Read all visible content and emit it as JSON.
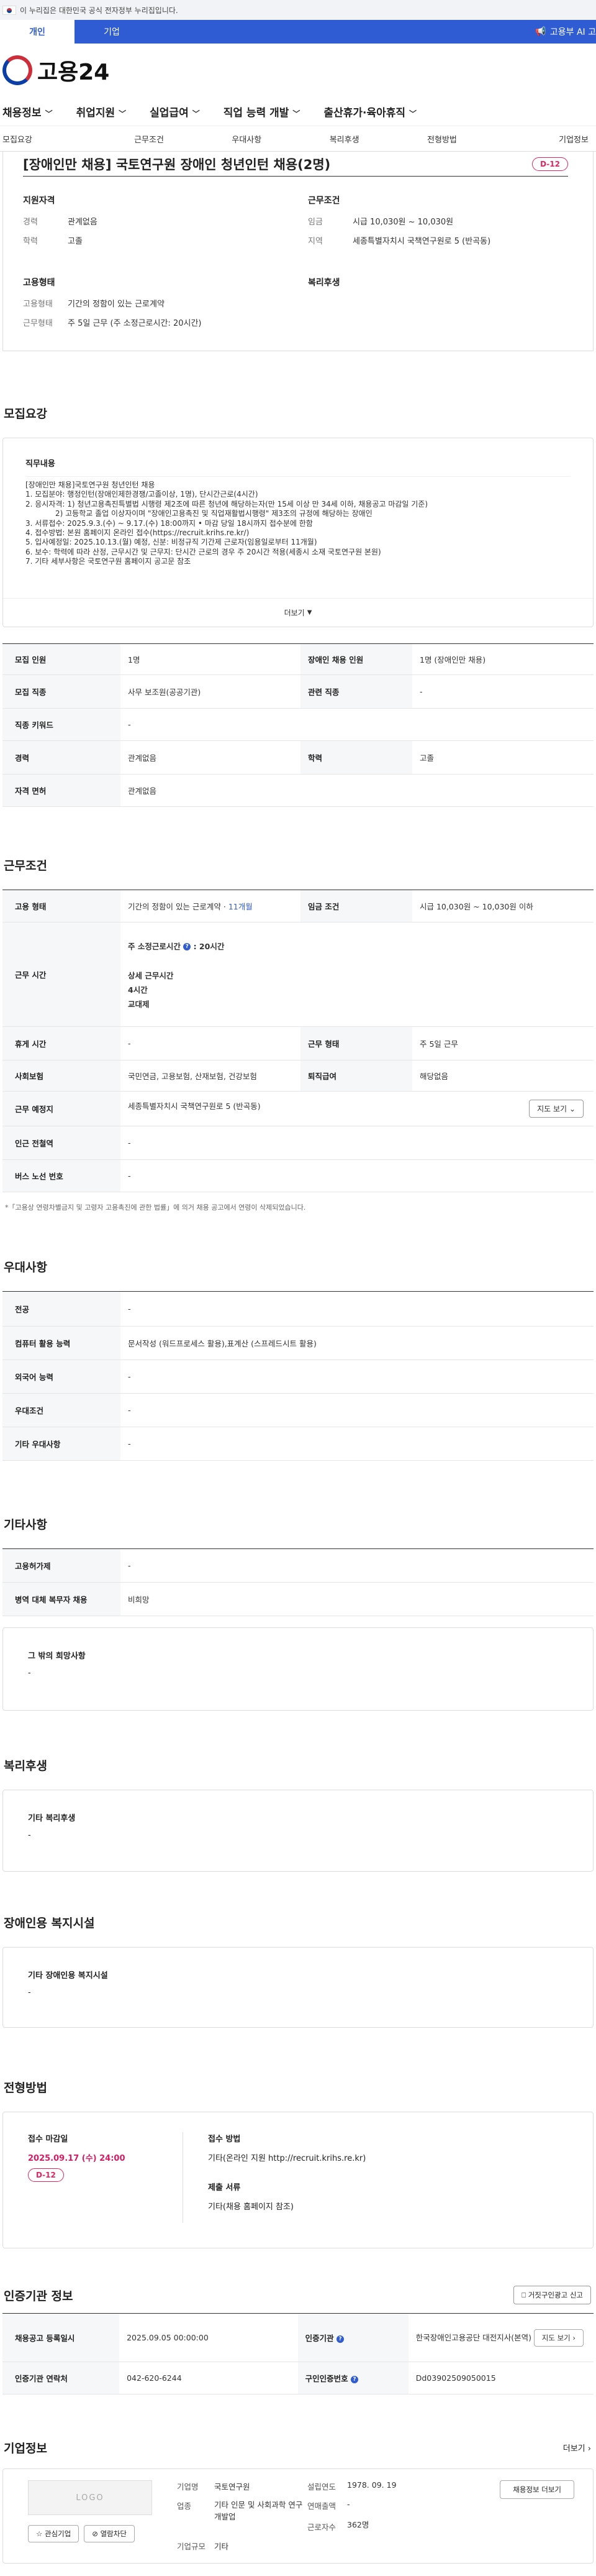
{
  "gov_banner": {
    "text": "이 누리집은 대한민국 공식 전자정부 누리집입니다."
  },
  "user_tabs": {
    "personal": "개인",
    "company": "기업",
    "ministry": "고용부 AI 고"
  },
  "logo": {
    "text": "고용24"
  },
  "main_nav": [
    {
      "label": "채용정보"
    },
    {
      "label": "취업지원"
    },
    {
      "label": "실업급여"
    },
    {
      "label": "직업 능력 개발"
    },
    {
      "label": "출산휴가·육아휴직"
    }
  ],
  "anchor_tabs": [
    "모집요강",
    "근무조건",
    "우대사항",
    "복리후생",
    "전형방법",
    "기업정보"
  ],
  "summary": {
    "title": "[장애인만 채용] 국토연구원 장애인 청년인턴 채용(2명)",
    "dday": "D-12",
    "qualification": {
      "heading": "지원자격",
      "rows": [
        {
          "k": "경력",
          "v": "관계없음"
        },
        {
          "k": "학력",
          "v": "고졸"
        }
      ]
    },
    "conditions": {
      "heading": "근무조건",
      "rows": [
        {
          "k": "임금",
          "v": "시급 10,030원 ~ 10,030원"
        },
        {
          "k": "지역",
          "v": "세종특별자치시 국책연구원로 5 (반곡동)"
        }
      ]
    },
    "employment": {
      "heading": "고용형태",
      "rows": [
        {
          "k": "고용형태",
          "v": "기간의 정함이 있는 근로계약"
        },
        {
          "k": "근무형태",
          "v": "주 5일 근무 (주 소정근로시간: 20시간)"
        }
      ]
    },
    "welfare": {
      "heading": "복리후생"
    }
  },
  "recruit": {
    "heading": "모집요강",
    "duty_label": "직무내용",
    "duty_lines": [
      "[장애인만 채용]국토연구원 청년인턴 채용",
      "1. 모집분야: 행정인턴(장애인제한경쟁/고졸이상, 1명), 단시간근로(4시간)",
      "2. 응시자격: 1) 청년고용촉진특별법 시행령 제2조에 따른 청년에 해당하는자(만 15세 이상 만 34세 이하, 채용공고 마감일 기준)",
      "　　　　2) 고등학교 졸업 이상자이며 \"장애인고용촉진 및 직업재활법시행령\" 제3조의 규정에 해당하는 장애인",
      "3. 서류접수: 2025.9.3.(수) ~ 9.17.(수) 18:00까지 • 마감 당일 18시까지 접수분에 한함",
      "4. 접수방법: 본원 홈페이지 온라인 접수(https://recruit.krihs.re.kr/)",
      "5. 입사예정일: 2025.10.13.(월) 예정, 신분: 비정규직 기간제 근로자(임용일로부터 11개월)",
      "6. 보수: 학력에 따라 산정, 근무시간 및 근무지: 단시간 근로의 경우 주 20시간 적용(세종시 소재 국토연구원 본원)",
      "7. 기타 세부사항은 국토연구원 홈페이지 공고문 참조"
    ],
    "more": "더보기",
    "table": {
      "headcount_k": "모집 인원",
      "headcount_v": "1명",
      "disabled_k": "장애인 채용 인원",
      "disabled_v": "1명 (장애인만 채용)",
      "job_k": "모집 직종",
      "job_v": "사무 보조원(공공기관)",
      "related_k": "관련 직종",
      "related_v": "-",
      "keyword_k": "직종 키워드",
      "keyword_v": "-",
      "career_k": "경력",
      "career_v": "관계없음",
      "edu_k": "학력",
      "edu_v": "고졸",
      "license_k": "자격 면허",
      "license_v": "관계없음"
    }
  },
  "work": {
    "heading": "근무조건",
    "emp_type_k": "고용 형태",
    "emp_type_v": "기간의 정함이 있는 근로계약 · ",
    "emp_type_months": "11개월",
    "wage_k": "임금 조건",
    "wage_v": "시급 10,030원 ~ 10,030원 이하",
    "hours_k": "근무 시간",
    "hours_weekly": "주 소정근로시간",
    "hours_weekly_v": ": 20시간",
    "hours_detail_label": "상세 근무시간",
    "hours_detail_1": "4시간",
    "hours_detail_2": "교대제",
    "rest_k": "휴게 시간",
    "rest_v": "-",
    "form_k": "근무 형태",
    "form_v": "주 5일 근무",
    "insurance_k": "사회보험",
    "insurance_v": "국민연금, 고용보험, 산재보험, 건강보험",
    "retire_k": "퇴직급여",
    "retire_v": "해당없음",
    "place_k": "근무 예정지",
    "place_v": "세종특별자치시 국책연구원로 5 (반곡동)",
    "map_btn": "지도 보기",
    "subway_k": "인근 전철역",
    "subway_v": "-",
    "bus_k": "버스 노선 번호",
    "bus_v": "-",
    "footnote": "*「고용상 연령차별금지 및 고령자 고용촉진에 관한 법률」에 의거 채용 공고에서 연령이 삭제되었습니다."
  },
  "preference": {
    "heading": "우대사항",
    "major_k": "전공",
    "major_v": "-",
    "computer_k": "컴퓨터 활용 능력",
    "computer_v": "문서작성 (워드프로세스 활용),표계산 (스프레드시트 활용)",
    "language_k": "외국어 능력",
    "language_v": "-",
    "pref_k": "우대조건",
    "pref_v": "-",
    "etc_k": "기타 우대사항",
    "etc_v": "-"
  },
  "etc": {
    "heading": "기타사항",
    "incentive_k": "고용허가제",
    "incentive_v": "-",
    "military_k": "병역 대체 복무자 채용",
    "military_v": "비희망",
    "wish_label": "그 밖의 희망사항",
    "wish_v": "-"
  },
  "welfare": {
    "heading": "복리후생",
    "label": "기타 복리후생",
    "value": "-"
  },
  "facility": {
    "heading": "장애인용 복지시설",
    "label": "기타 장애인용 복지시설",
    "value": "-"
  },
  "selection": {
    "heading": "전형방법",
    "deadline_label": "접수 마감일",
    "deadline": "2025.09.17 (수) 24:00",
    "dday": "D-12",
    "method_label": "접수 방법",
    "method": "기타(온라인 지원 http://recruit.krihs.re.kr)",
    "docs_label": "제출 서류",
    "docs": "기타(채용 홈페이지 참조)"
  },
  "cert": {
    "heading": "인증기관 정보",
    "report_btn": "거짓구인광고 신고",
    "reg_k": "채용공고 등록일시",
    "reg_v": "2025.09.05 00:00:00",
    "org_k": "인증기관",
    "org_v": "한국장애인고용공단 대전지사(본역)",
    "map_btn": "지도 보기",
    "contact_k": "인증기관 연락처",
    "contact_v": "042-620-6244",
    "no_k": "구인인증번호",
    "no_v": "Dd03902509050015"
  },
  "company": {
    "heading": "기업정보",
    "more": "더보기",
    "logo_ph": "LOGO",
    "fav_btn": "관심기업",
    "block_btn": "열람차단",
    "list_btn": "채용정보 더보기",
    "name_k": "기업명",
    "name_v": "국토연구원",
    "founded_k": "설립연도",
    "founded_v": "1978. 09. 19",
    "industry_k": "업종",
    "industry_v": "기타 인문 및 사회과학 연구개발업",
    "sales_k": "연매출액",
    "sales_v": "-",
    "staff_k": "근로자수",
    "staff_v": "362명",
    "size_k": "기업규모",
    "size_v": "기타"
  }
}
